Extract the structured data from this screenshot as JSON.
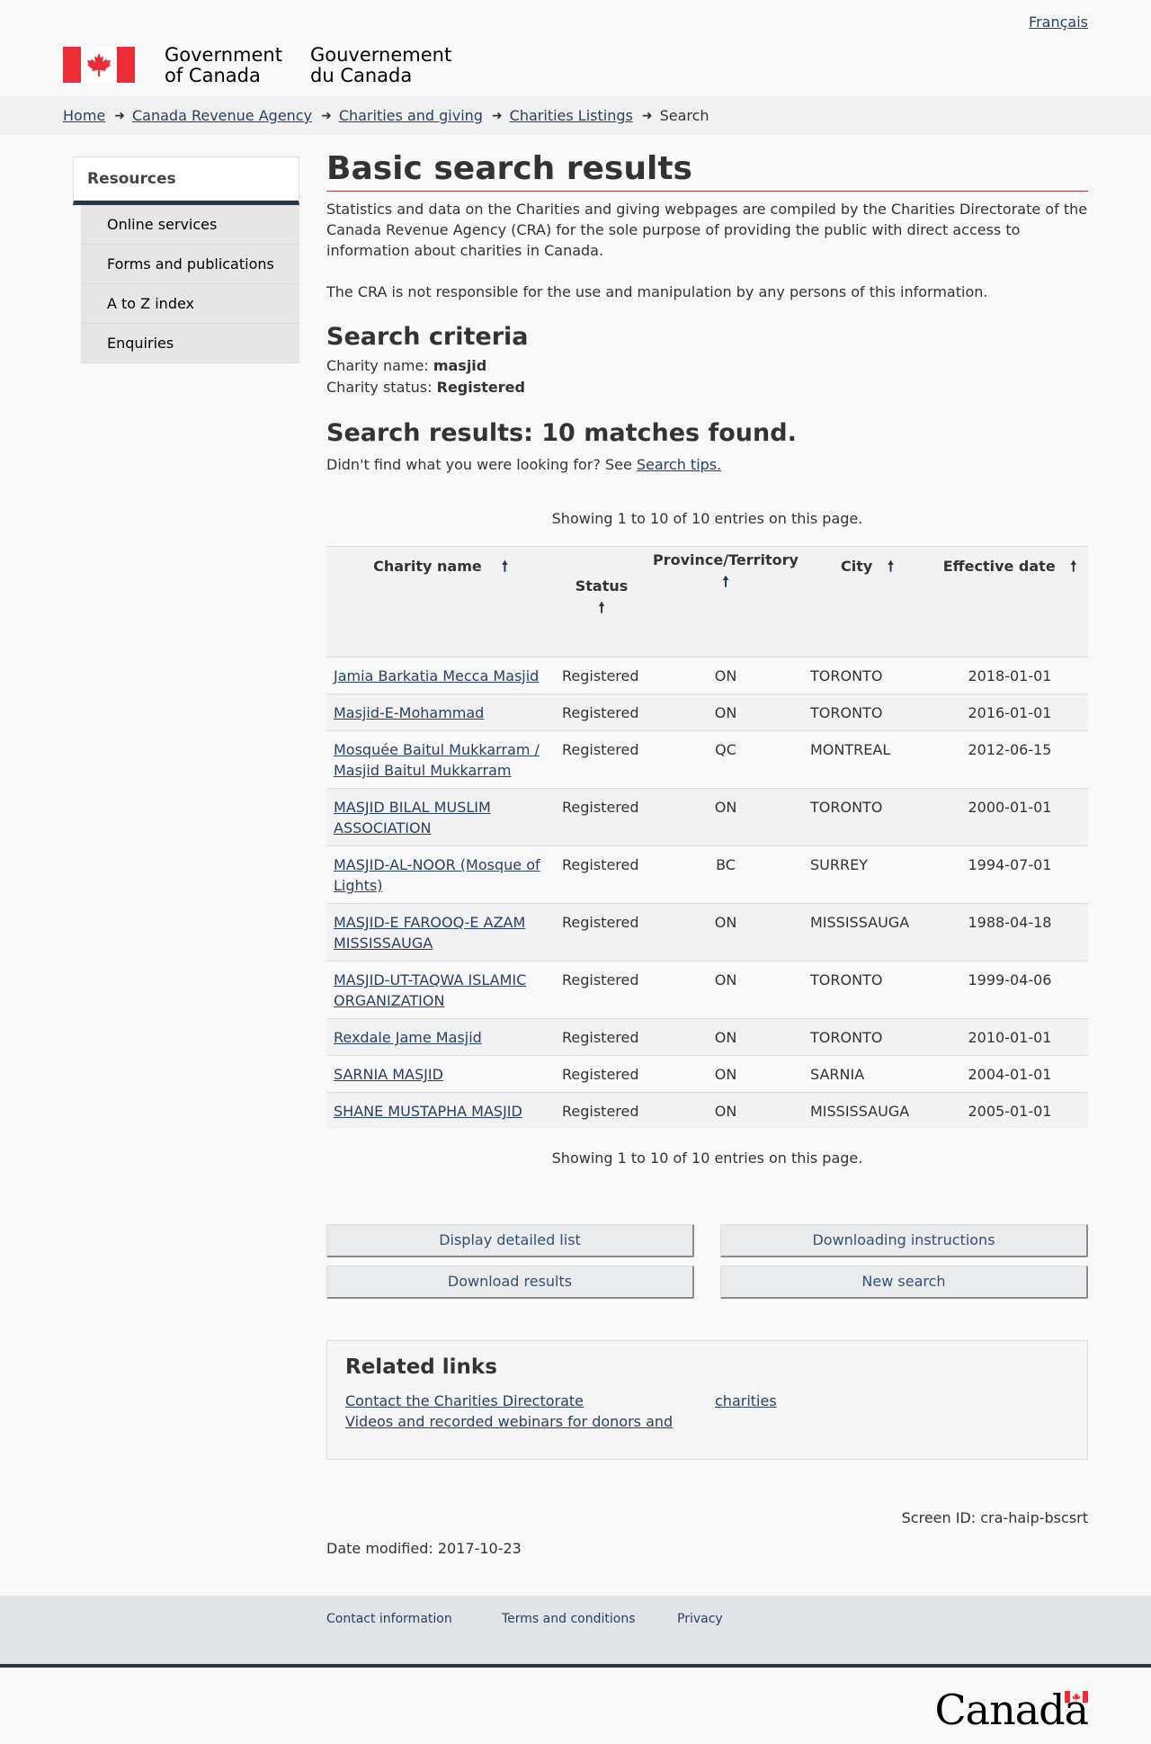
{
  "header": {
    "language_link": "Français",
    "signature_en_line1": "Government",
    "signature_en_line2": "of Canada",
    "signature_fr_line1": "Gouvernement",
    "signature_fr_line2": "du Canada",
    "flag_color": "#eb2d37"
  },
  "breadcrumb": {
    "items": [
      "Home",
      "Canada Revenue Agency",
      "Charities and giving",
      "Charities Listings"
    ],
    "current": "Search"
  },
  "sidebar": {
    "title": "Resources",
    "items": [
      "Online services",
      "Forms and publications",
      "A to Z index",
      "Enquiries"
    ]
  },
  "main": {
    "title": "Basic search results",
    "intro_1": "Statistics and data on the Charities and giving webpages are compiled by the Charities Directorate of the Canada Revenue Agency (CRA) for the sole purpose of providing the public with direct access to information about charities in Canada.",
    "intro_2": "The CRA is not responsible for the use and manipulation by any persons of this information.",
    "criteria_heading": "Search criteria",
    "criteria_name_label": "Charity name:",
    "criteria_name_value": "masjid",
    "criteria_status_label": "Charity status:",
    "criteria_status_value": "Registered",
    "results_heading": "Search results: 10 matches found.",
    "tips_text": "Didn't find what you were looking for? See",
    "tips_link": "Search tips.",
    "showing": "Showing 1 to 10 of 10 entries on this page."
  },
  "table": {
    "columns": [
      "Charity name",
      "Status",
      "Province/Territory",
      "City",
      "Effective date"
    ],
    "rows": [
      {
        "name": "Jamia Barkatia Mecca Masjid",
        "status": "Registered",
        "prov": "ON",
        "city": "TORONTO",
        "date": "2018-01-01"
      },
      {
        "name": "Masjid-E-Mohammad",
        "status": "Registered",
        "prov": "ON",
        "city": "TORONTO",
        "date": "2016-01-01"
      },
      {
        "name": "Mosquée Baitul Mukkarram / Masjid Baitul Mukkarram",
        "status": "Registered",
        "prov": "QC",
        "city": "MONTREAL",
        "date": "2012-06-15"
      },
      {
        "name": "MASJID BILAL MUSLIM ASSOCIATION",
        "status": "Registered",
        "prov": "ON",
        "city": "TORONTO",
        "date": "2000-01-01"
      },
      {
        "name": "MASJID-AL-NOOR (Mosque of Lights)",
        "status": "Registered",
        "prov": "BC",
        "city": "SURREY",
        "date": "1994-07-01"
      },
      {
        "name": "MASJID-E FAROOQ-E AZAM MISSISSAUGA",
        "status": "Registered",
        "prov": "ON",
        "city": "MISSISSAUGA",
        "date": "1988-04-18"
      },
      {
        "name": "MASJID-UT-TAQWA ISLAMIC ORGANIZATION",
        "status": "Registered",
        "prov": "ON",
        "city": "TORONTO",
        "date": "1999-04-06"
      },
      {
        "name": "Rexdale Jame Masjid",
        "status": "Registered",
        "prov": "ON",
        "city": "TORONTO",
        "date": "2010-01-01"
      },
      {
        "name": "SARNIA MASJID",
        "status": "Registered",
        "prov": "ON",
        "city": "SARNIA",
        "date": "2004-01-01"
      },
      {
        "name": "SHANE MUSTAPHA MASJID",
        "status": "Registered",
        "prov": "ON",
        "city": "MISSISSAUGA",
        "date": "2005-01-01"
      }
    ]
  },
  "buttons": {
    "detailed": "Display detailed list",
    "download_instructions": "Downloading instructions",
    "download": "Download results",
    "new_search": "New search"
  },
  "related": {
    "title": "Related links",
    "link1": "Contact the Charities Directorate",
    "link2": "Videos and recorded webinars for donors and",
    "link3": "charities"
  },
  "meta": {
    "screen_id": "Screen ID: cra-haip-bscsrt",
    "date_modified": "Date modified: 2017-10-23"
  },
  "footer": {
    "links": [
      "Contact information",
      "Terms and conditions",
      "Privacy"
    ],
    "wordmark": "Canada"
  }
}
